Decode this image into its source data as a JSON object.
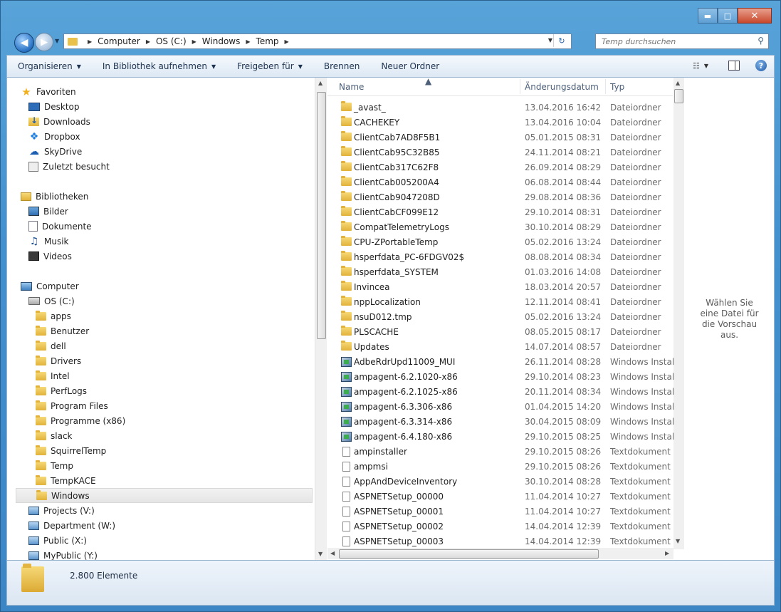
{
  "window": {
    "caption_minimize": "▬",
    "caption_maximize": "□",
    "caption_close": "✕"
  },
  "address": {
    "crumbs": [
      "Computer",
      "OS (C:)",
      "Windows",
      "Temp"
    ]
  },
  "search": {
    "placeholder": "Temp durchsuchen"
  },
  "toolbar": {
    "organize": "Organisieren",
    "library": "In Bibliothek aufnehmen",
    "share": "Freigeben für",
    "burn": "Brennen",
    "new_folder": "Neuer Ordner",
    "help": "?"
  },
  "nav": {
    "favorites": "Favoriten",
    "desktop": "Desktop",
    "downloads": "Downloads",
    "dropbox": "Dropbox",
    "skydrive": "SkyDrive",
    "recent": "Zuletzt besucht",
    "libraries": "Bibliotheken",
    "pictures": "Bilder",
    "documents": "Dokumente",
    "music": "Musik",
    "videos": "Videos",
    "computer": "Computer",
    "drive_c": "OS (C:)",
    "folders": [
      "apps",
      "Benutzer",
      "dell",
      "Drivers",
      "Intel",
      "PerfLogs",
      "Program Files",
      "Programme (x86)",
      "slack",
      "SquirrelTemp",
      "Temp",
      "TempKACE",
      "Windows"
    ],
    "drives": [
      "Projects (V:)",
      "Department (W:)",
      "Public (X:)",
      "MyPublic (Y:)"
    ]
  },
  "columns": {
    "name": "Name",
    "date": "Änderungsdatum",
    "type": "Typ"
  },
  "files": [
    {
      "name": "_avast_",
      "date": "13.04.2016 16:42",
      "type": "Dateiordner",
      "icon": "folder"
    },
    {
      "name": "CACHEKEY",
      "date": "13.04.2016 10:04",
      "type": "Dateiordner",
      "icon": "folder"
    },
    {
      "name": "ClientCab7AD8F5B1",
      "date": "05.01.2015 08:31",
      "type": "Dateiordner",
      "icon": "folder"
    },
    {
      "name": "ClientCab95C32B85",
      "date": "24.11.2014 08:21",
      "type": "Dateiordner",
      "icon": "folder"
    },
    {
      "name": "ClientCab317C62F8",
      "date": "26.09.2014 08:29",
      "type": "Dateiordner",
      "icon": "folder"
    },
    {
      "name": "ClientCab005200A4",
      "date": "06.08.2014 08:44",
      "type": "Dateiordner",
      "icon": "folder"
    },
    {
      "name": "ClientCab9047208D",
      "date": "29.08.2014 08:36",
      "type": "Dateiordner",
      "icon": "folder"
    },
    {
      "name": "ClientCabCF099E12",
      "date": "29.10.2014 08:31",
      "type": "Dateiordner",
      "icon": "folder"
    },
    {
      "name": "CompatTelemetryLogs",
      "date": "30.10.2014 08:29",
      "type": "Dateiordner",
      "icon": "folder"
    },
    {
      "name": "CPU-ZPortableTemp",
      "date": "05.02.2016 13:24",
      "type": "Dateiordner",
      "icon": "folder"
    },
    {
      "name": "hsperfdata_PC-6FDGV02$",
      "date": "08.08.2014 08:34",
      "type": "Dateiordner",
      "icon": "folder"
    },
    {
      "name": "hsperfdata_SYSTEM",
      "date": "01.03.2016 14:08",
      "type": "Dateiordner",
      "icon": "folder"
    },
    {
      "name": "Invincea",
      "date": "18.03.2014 20:57",
      "type": "Dateiordner",
      "icon": "folder"
    },
    {
      "name": "nppLocalization",
      "date": "12.11.2014 08:41",
      "type": "Dateiordner",
      "icon": "folder"
    },
    {
      "name": "nsuD012.tmp",
      "date": "05.02.2016 13:24",
      "type": "Dateiordner",
      "icon": "folder"
    },
    {
      "name": "PLSCACHE",
      "date": "08.05.2015 08:17",
      "type": "Dateiordner",
      "icon": "folder"
    },
    {
      "name": "Updates",
      "date": "14.07.2014 08:57",
      "type": "Dateiordner",
      "icon": "folder"
    },
    {
      "name": "AdbeRdrUpd11009_MUI",
      "date": "26.11.2014 08:28",
      "type": "Windows Installer",
      "icon": "msi"
    },
    {
      "name": "ampagent-6.2.1020-x86",
      "date": "29.10.2014 08:23",
      "type": "Windows Installer",
      "icon": "msi"
    },
    {
      "name": "ampagent-6.2.1025-x86",
      "date": "20.11.2014 08:34",
      "type": "Windows Installer",
      "icon": "msi"
    },
    {
      "name": "ampagent-6.3.306-x86",
      "date": "01.04.2015 14:20",
      "type": "Windows Installer",
      "icon": "msi"
    },
    {
      "name": "ampagent-6.3.314-x86",
      "date": "30.04.2015 08:09",
      "type": "Windows Installer",
      "icon": "msi"
    },
    {
      "name": "ampagent-6.4.180-x86",
      "date": "29.10.2015 08:25",
      "type": "Windows Installer",
      "icon": "msi"
    },
    {
      "name": "ampinstaller",
      "date": "29.10.2015 08:26",
      "type": "Textdokument",
      "icon": "txt"
    },
    {
      "name": "ampmsi",
      "date": "29.10.2015 08:26",
      "type": "Textdokument",
      "icon": "txt"
    },
    {
      "name": "AppAndDeviceInventory",
      "date": "30.10.2014 08:28",
      "type": "Textdokument",
      "icon": "txt"
    },
    {
      "name": "ASPNETSetup_00000",
      "date": "11.04.2014 10:27",
      "type": "Textdokument",
      "icon": "txt"
    },
    {
      "name": "ASPNETSetup_00001",
      "date": "11.04.2014 10:27",
      "type": "Textdokument",
      "icon": "txt"
    },
    {
      "name": "ASPNETSetup_00002",
      "date": "14.04.2014 12:39",
      "type": "Textdokument",
      "icon": "txt"
    },
    {
      "name": "ASPNETSetup_00003",
      "date": "14.04.2014 12:39",
      "type": "Textdokument",
      "icon": "txt"
    }
  ],
  "preview": {
    "text": "Wählen Sie eine Datei für die Vorschau aus."
  },
  "status": {
    "count": "2.800 Elemente"
  }
}
